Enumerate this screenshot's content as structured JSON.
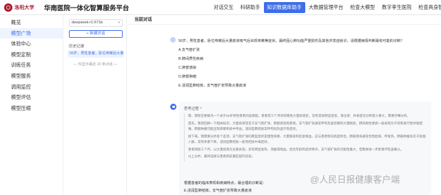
{
  "header": {
    "logo_text": "洛阳大学",
    "platform_title": "华南医院一体化智算服务平台",
    "nav": [
      {
        "label": "对话交互",
        "active": false
      },
      {
        "label": "科研助手",
        "active": false
      },
      {
        "label": "知识数据库助手",
        "active": true
      },
      {
        "label": "大数据管理平台",
        "active": false
      },
      {
        "label": "检查大模型",
        "active": false
      },
      {
        "label": "数字孪生医院",
        "active": false
      },
      {
        "label": "检查具身智能",
        "active": false
      }
    ]
  },
  "sidebar": {
    "items": [
      {
        "label": "概览",
        "active": false
      },
      {
        "label": "模型广场",
        "active": true
      },
      {
        "label": "体验中心",
        "active": false
      },
      {
        "label": "模型定制",
        "active": false
      },
      {
        "label": "训练任务",
        "active": false
      },
      {
        "label": "模型服务",
        "active": false
      },
      {
        "label": "调用监控",
        "active": false
      },
      {
        "label": "模型评估",
        "active": false
      },
      {
        "label": "模型压缩",
        "active": false
      }
    ]
  },
  "history": {
    "model_select": "deepseek-r1:671b",
    "new_chat_label": "+ 新建对话",
    "section_label": "历史记录",
    "items": [
      "56岁，男性患者，卧位咳嗽后大量…"
    ],
    "note": "— 仅显示最近 20 条对话 —"
  },
  "main": {
    "header_title": "当前对话",
    "question_lines": [
      "56岁，男性患者，卧位咳嗽后大量痰液吸气后出现咳嗽等症状，最终因心肺功能严重损伤及其他并发症就诊，请根据病情判断最有可能的诊断？",
      "A.支气管扩张",
      "B.肺间质性疾病",
      "C.肺部感染",
      "D.肺部肿瘤",
      "E.浸润型肺结核，支气管扩张导致大量痰液"
    ],
    "think_toggle": "思考过程 ^",
    "think_paragraphs": [
      "嗯，我现在要解决一个关于56岁男性患者的选择题。患者有三个月的咳嗽性大量痰液史，没有其他明显症状。请注意：并发症对诊断意义重大，需要仔细分析。",
      "首先，我得回顾一下相关知识。大量痰液常见于支气管扩张、肺部感染等疾病，支气管扩张通常伴有反复咳嗽和大量脓痰，肺间质性疾病一般表现为干咳和进行性呼吸困难，肺部肿瘤可能出现咳嗽和痰中带血，浸润型肺结核常伴有低热盗汗等症状。",
      "接下来，我需要分析各个选项。支气管扩张的典型症状是慢性咳嗽、大量脓痰和反复咯血，这与患者情况高度吻合。肺部感染通常急性起病，伴发热。肺部肿瘤多见于吸烟人群，常有体重下降。浸润型肺结核一般有结核中毒症状。",
      "患者病程三个月，以大量痰液为主要表现，没有明显发热、消瘦或咯血。结合年龄和症状特点，支气管扩张的可能性最大，但需要进一步影像学检查确认。",
      "以上分析，最终选择与患者病史最匹配的答案。"
    ],
    "final_intro": "根据患者的临床表现和疾病特点，最合理的诊断是：",
    "final_answer": "E.浸润型肺结核，支气管扩张导致大量痰液",
    "watermark": "@人民日报健康客户端"
  },
  "colors": {
    "accent": "#3e6ee8",
    "brand": "#a8172f"
  }
}
